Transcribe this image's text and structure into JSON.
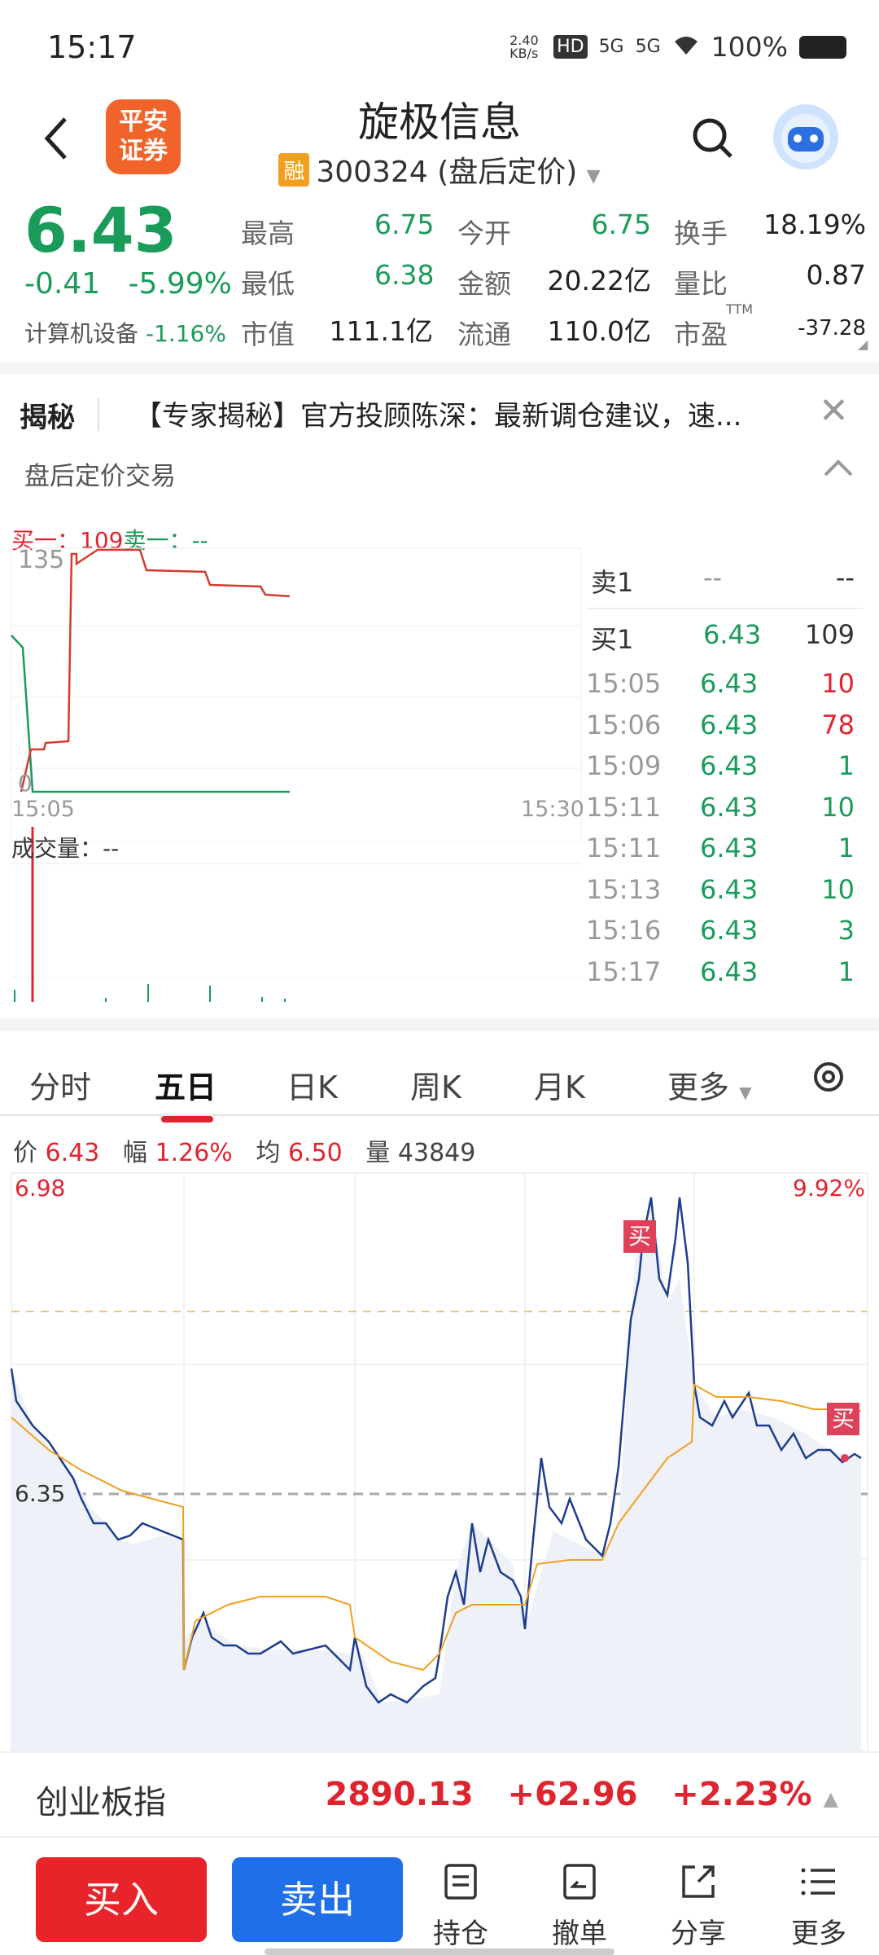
{
  "status_bar": {
    "time": "15:17",
    "net_speed": "2.40 KB/s",
    "hd": "HD",
    "sig1": "5G",
    "sig2": "5G",
    "battery": "100%"
  },
  "header": {
    "broker_logo": "平安证券",
    "title": "旋极信息",
    "badge": "融",
    "subtitle": "300324 (盘后定价)"
  },
  "quote": {
    "price": "6.43",
    "change": "-0.41",
    "change_pct": "-5.99%",
    "sector": "计算机设备",
    "sector_pct": "-1.16%",
    "high_label": "最高",
    "high": "6.75",
    "open_label": "今开",
    "open": "6.75",
    "turnover_label": "换手",
    "turnover": "18.19%",
    "low_label": "最低",
    "low": "6.38",
    "amount_label": "金额",
    "amount": "20.22亿",
    "ratio_label": "量比",
    "ratio": "0.87",
    "mcap_label": "市值",
    "mcap": "111.1亿",
    "float_label": "流通",
    "float": "110.0亿",
    "pe_label": "市盈",
    "pe_sup": "TTM",
    "pe": "-37.28"
  },
  "banner": {
    "tag": "揭秘",
    "text": "【专家揭秘】官方投顾陈深：最新调仓建议，速..."
  },
  "after_hours": {
    "label": "盘后定价交易",
    "buy_label": "买一：",
    "buy_value": "109",
    "sell_label": "卖一：",
    "sell_value": "--",
    "y_top": "135",
    "y_bottom": "0",
    "t_start": "15:05",
    "t_end": "15:30",
    "volume_label": "成交量：",
    "volume_value": "--",
    "ask": {
      "label": "卖1",
      "price": "--",
      "vol": "--"
    },
    "bid": {
      "label": "买1",
      "price": "6.43",
      "vol": "109"
    },
    "trades": [
      {
        "time": "15:05",
        "price": "6.43",
        "vol": "10",
        "color": "#e0242f"
      },
      {
        "time": "15:06",
        "price": "6.43",
        "vol": "78",
        "color": "#e0242f"
      },
      {
        "time": "15:09",
        "price": "6.43",
        "vol": "1",
        "color": "#1a9b5a"
      },
      {
        "time": "15:11",
        "price": "6.43",
        "vol": "10",
        "color": "#1a9b5a"
      },
      {
        "time": "15:11",
        "price": "6.43",
        "vol": "1",
        "color": "#1a9b5a"
      },
      {
        "time": "15:13",
        "price": "6.43",
        "vol": "10",
        "color": "#1a9b5a"
      },
      {
        "time": "15:16",
        "price": "6.43",
        "vol": "3",
        "color": "#1a9b5a"
      },
      {
        "time": "15:17",
        "price": "6.43",
        "vol": "1",
        "color": "#1a9b5a"
      }
    ]
  },
  "tabs": {
    "items": [
      "分时",
      "五日",
      "日K",
      "周K",
      "月K",
      "更多"
    ],
    "active": "五日"
  },
  "five_day": {
    "price_label": "价",
    "price": "6.43",
    "amp_label": "幅",
    "amp": "1.26%",
    "avg_label": "均",
    "avg": "6.50",
    "vol_label": "量",
    "vol": "43849",
    "y_top": "6.98",
    "y_mid": "6.35",
    "pct_top": "9.92%",
    "buy_marker": "买"
  },
  "index": {
    "name": "创业板指",
    "value": "2890.13",
    "change": "+62.96",
    "change_pct": "+2.23%"
  },
  "bottom_bar": {
    "buy": "买入",
    "sell": "卖出",
    "hold": "持仓",
    "cancel": "撤单",
    "share": "分享",
    "more": "更多"
  }
}
